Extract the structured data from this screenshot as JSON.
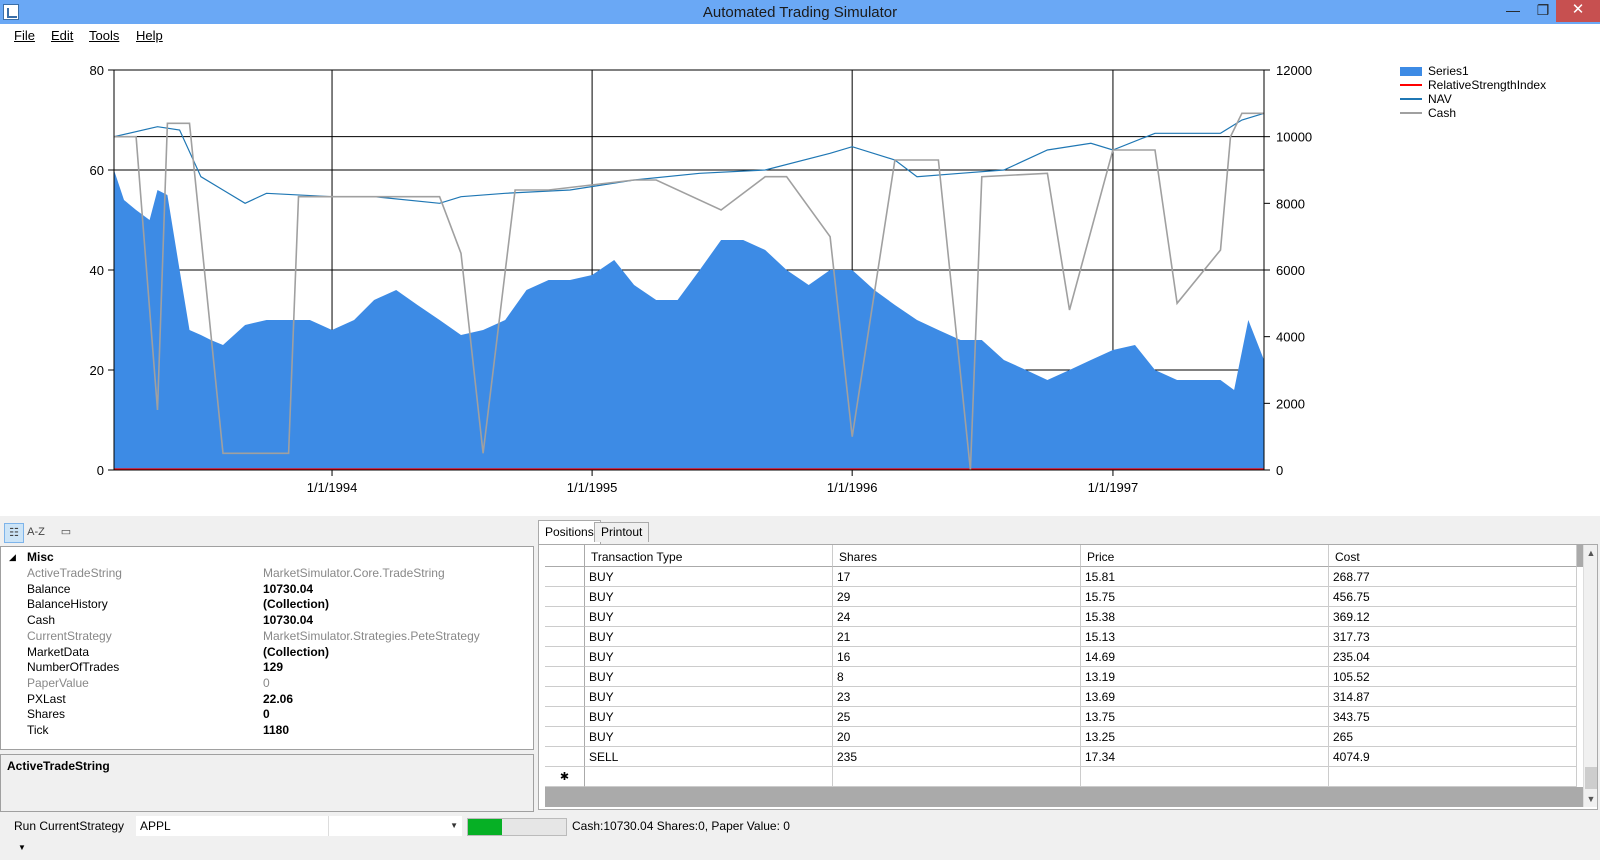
{
  "window": {
    "title": "Automated Trading Simulator",
    "minimize": "—",
    "maximize": "❐",
    "close": "✕"
  },
  "menu": [
    "File",
    "Edit",
    "Tools",
    "Help"
  ],
  "chart_data": {
    "type": "area",
    "title": "",
    "left_axis": {
      "min": 0,
      "max": 80,
      "ticks": [
        "0",
        "20",
        "40",
        "60",
        "80"
      ]
    },
    "right_axis": {
      "min": 0,
      "max": 12000,
      "ticks": [
        "0",
        "2000",
        "4000",
        "6000",
        "8000",
        "10000",
        "12000"
      ]
    },
    "x_axis": {
      "min": "1993-03-01",
      "max": "1997-08-01",
      "ticks": [
        "1/1/1994",
        "1/1/1995",
        "1/1/1996",
        "1/1/1997"
      ]
    },
    "legend_placement": "top-right",
    "grid": true,
    "legend": [
      {
        "name": "Series1",
        "color": "#3d8be5",
        "style": "area"
      },
      {
        "name": "RelativeStrengthIndex",
        "color": "#ff0000",
        "style": "line"
      },
      {
        "name": "NAV",
        "color": "#1f77b4",
        "style": "line"
      },
      {
        "name": "Cash",
        "color": "#a0a0a0",
        "style": "line"
      }
    ],
    "series": [
      {
        "name": "Series1",
        "axis": "left",
        "x": [
          "1993-03-01",
          "1993-03-15",
          "1993-04-01",
          "1993-04-20",
          "1993-05-01",
          "1993-05-15",
          "1993-06-01",
          "1993-06-15",
          "1993-07-01",
          "1993-07-15",
          "1993-08-01",
          "1993-09-01",
          "1993-10-01",
          "1993-11-01",
          "1993-12-01",
          "1994-01-01",
          "1994-02-01",
          "1994-03-01",
          "1994-04-01",
          "1994-05-01",
          "1994-06-01",
          "1994-07-01",
          "1994-08-01",
          "1994-09-01",
          "1994-10-01",
          "1994-11-01",
          "1994-12-01",
          "1995-01-01",
          "1995-02-01",
          "1995-03-01",
          "1995-04-01",
          "1995-05-01",
          "1995-06-01",
          "1995-07-01",
          "1995-08-01",
          "1995-09-01",
          "1995-10-01",
          "1995-11-01",
          "1995-12-01",
          "1996-01-01",
          "1996-02-01",
          "1996-03-01",
          "1996-04-01",
          "1996-05-01",
          "1996-06-01",
          "1996-07-01",
          "1996-08-01",
          "1996-09-01",
          "1996-10-01",
          "1996-11-01",
          "1996-12-01",
          "1997-01-01",
          "1997-02-01",
          "1997-03-01",
          "1997-04-01",
          "1997-05-01",
          "1997-06-01",
          "1997-06-20",
          "1997-07-10",
          "1997-08-01"
        ],
        "y": [
          60,
          54,
          52,
          50,
          56,
          55,
          40,
          28,
          27,
          26,
          25,
          29,
          30,
          30,
          30,
          28,
          30,
          34,
          36,
          33,
          30,
          27,
          28,
          30,
          36,
          38,
          38,
          39,
          42,
          37,
          34,
          34,
          40,
          46,
          46,
          44,
          40,
          37,
          40,
          40,
          36,
          33,
          30,
          28,
          26,
          26,
          22,
          20,
          18,
          20,
          22,
          24,
          25,
          20,
          18,
          18,
          18,
          16,
          30,
          22
        ]
      },
      {
        "name": "RelativeStrengthIndex",
        "axis": "left",
        "x": [
          "1993-03-01",
          "1997-08-01"
        ],
        "y": [
          0.2,
          0.2
        ]
      },
      {
        "name": "NAV",
        "axis": "right",
        "x": [
          "1993-03-01",
          "1993-05-01",
          "1993-06-01",
          "1993-07-01",
          "1993-08-01",
          "1993-09-01",
          "1993-10-01",
          "1994-01-01",
          "1994-03-01",
          "1994-06-01",
          "1994-07-01",
          "1994-09-01",
          "1994-12-01",
          "1995-03-01",
          "1995-06-01",
          "1995-09-01",
          "1995-12-01",
          "1996-01-01",
          "1996-03-01",
          "1996-04-01",
          "1996-06-01",
          "1996-08-01",
          "1996-10-01",
          "1996-12-01",
          "1997-01-01",
          "1997-03-01",
          "1997-06-01",
          "1997-07-01",
          "1997-08-01"
        ],
        "y": [
          10000,
          10300,
          10200,
          8800,
          8400,
          8000,
          8300,
          8200,
          8200,
          8000,
          8200,
          8300,
          8400,
          8700,
          8900,
          9000,
          9500,
          9700,
          9300,
          8800,
          8900,
          9000,
          9600,
          9800,
          9600,
          10100,
          10100,
          10500,
          10700
        ]
      },
      {
        "name": "Cash",
        "axis": "right",
        "x": [
          "1993-03-01",
          "1993-04-01",
          "1993-05-01",
          "1993-05-15",
          "1993-06-15",
          "1993-08-01",
          "1993-11-01",
          "1993-11-15",
          "1994-06-01",
          "1994-07-01",
          "1994-08-01",
          "1994-09-15",
          "1994-11-01",
          "1995-03-01",
          "1995-04-01",
          "1995-07-01",
          "1995-09-01",
          "1995-10-01",
          "1995-12-01",
          "1996-01-01",
          "1996-03-01",
          "1996-05-01",
          "1996-06-15",
          "1996-07-01",
          "1996-10-01",
          "1996-11-01",
          "1997-01-01",
          "1997-03-01",
          "1997-04-01",
          "1997-06-01",
          "1997-06-15",
          "1997-07-01",
          "1997-08-01"
        ],
        "y": [
          10000,
          10000,
          1800,
          10400,
          10400,
          500,
          500,
          8200,
          8200,
          6500,
          500,
          8400,
          8400,
          8700,
          8700,
          7800,
          8800,
          8800,
          7000,
          1000,
          9300,
          9300,
          0,
          8800,
          8900,
          4800,
          9600,
          9600,
          5000,
          6600,
          10000,
          10700,
          10700
        ]
      }
    ]
  },
  "props_toolbar": {
    "categorized": "categorized-icon",
    "alphabetical": "A-Z",
    "pages": "property-pages-icon"
  },
  "props": {
    "category": "Misc",
    "rows": [
      {
        "name": "ActiveTradeString",
        "value": "MarketSimulator.Core.TradeString",
        "muted": true
      },
      {
        "name": "Balance",
        "value": "10730.04",
        "muted": false
      },
      {
        "name": "BalanceHistory",
        "value": "(Collection)",
        "muted": false
      },
      {
        "name": "Cash",
        "value": "10730.04",
        "muted": false
      },
      {
        "name": "CurrentStrategy",
        "value": "MarketSimulator.Strategies.PeteStrategy",
        "muted": true
      },
      {
        "name": "MarketData",
        "value": "(Collection)",
        "muted": false
      },
      {
        "name": "NumberOfTrades",
        "value": "129",
        "muted": false
      },
      {
        "name": "PaperValue",
        "value": "0",
        "muted": true
      },
      {
        "name": "PXLast",
        "value": "22.06",
        "muted": false
      },
      {
        "name": "Shares",
        "value": "0",
        "muted": false
      },
      {
        "name": "Tick",
        "value": "1180",
        "muted": false
      }
    ],
    "description_title": "ActiveTradeString"
  },
  "tabs": [
    "Positions",
    "Printout"
  ],
  "positions": {
    "columns": [
      "Transaction Type",
      "Shares",
      "Price",
      "Cost"
    ],
    "rows": [
      [
        "BUY",
        "17",
        "15.81",
        "268.77"
      ],
      [
        "BUY",
        "29",
        "15.75",
        "456.75"
      ],
      [
        "BUY",
        "24",
        "15.38",
        "369.12"
      ],
      [
        "BUY",
        "21",
        "15.13",
        "317.73"
      ],
      [
        "BUY",
        "16",
        "14.69",
        "235.04"
      ],
      [
        "BUY",
        "8",
        "13.19",
        "105.52"
      ],
      [
        "BUY",
        "23",
        "13.69",
        "314.87"
      ],
      [
        "BUY",
        "25",
        "13.75",
        "343.75"
      ],
      [
        "BUY",
        "20",
        "13.25",
        "265"
      ],
      [
        "SELL",
        "235",
        "17.34",
        "4074.9"
      ]
    ],
    "new_row_marker": "✱"
  },
  "status": {
    "run_label": "Run CurrentStrategy",
    "symbol": "APPL",
    "progress": 0.35,
    "progress_color": "#06b025",
    "text": "Cash:10730.04 Shares:0, Paper Value: 0"
  }
}
